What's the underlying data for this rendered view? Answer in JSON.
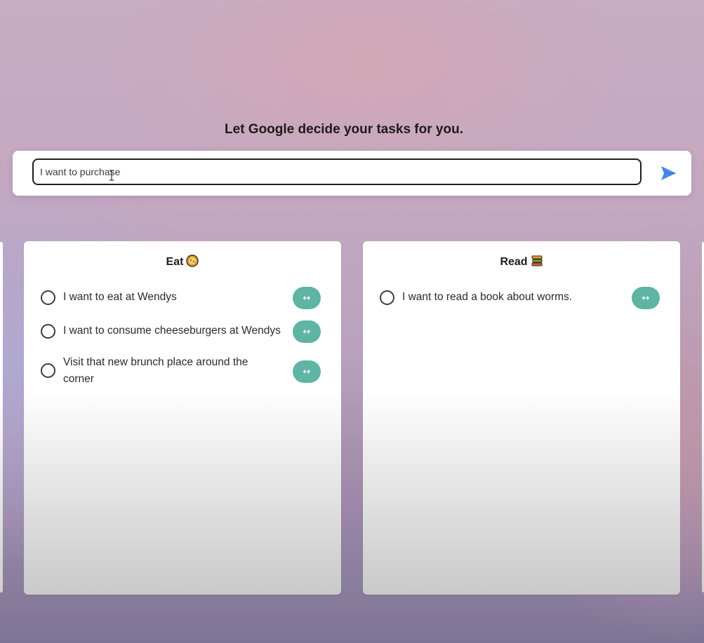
{
  "header": {
    "title": "Let Google decide your tasks for you."
  },
  "task_input": {
    "value": "I want to purchase",
    "placeholder": ""
  },
  "send_icon": "paper-plane-send-icon",
  "accent_colors": {
    "move_button": "#5fb4a3",
    "send_icon": "#4a86e8"
  },
  "categories": [
    {
      "title": "Eat",
      "emoji_icon": "cookie-emoji-icon",
      "tasks": [
        {
          "text": "I want to eat at Wendys",
          "move_label": "↔"
        },
        {
          "text": "I want to consume cheeseburgers at Wendys",
          "move_label": "↔"
        },
        {
          "text": "Visit that new brunch place around the corner",
          "move_label": "↔"
        }
      ]
    },
    {
      "title": "Read",
      "emoji_icon": "books-emoji-icon",
      "tasks": [
        {
          "text": "I want to read a book about worms.",
          "move_label": "↔"
        }
      ]
    }
  ]
}
